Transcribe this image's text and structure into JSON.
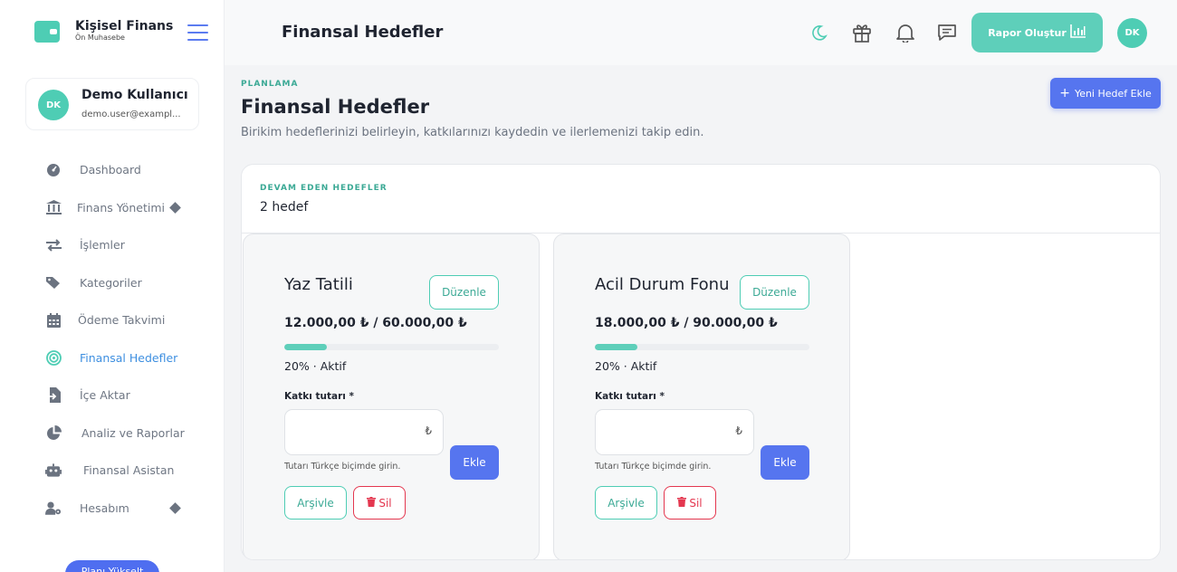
{
  "brand": {
    "title": "Kişisel Finans",
    "subtitle": "Ön Muhasebe"
  },
  "user": {
    "initials": "DK",
    "name": "Demo Kullanıcı",
    "email": "demo.user@exampl..."
  },
  "sidebar": {
    "items": [
      {
        "label": "Dashboard",
        "icon": "gauge-icon"
      },
      {
        "label": "Finans Yönetimi",
        "icon": "bank-icon",
        "expandable": true
      },
      {
        "label": "İşlemler",
        "icon": "exchange-icon"
      },
      {
        "label": "Kategoriler",
        "icon": "tags-icon"
      },
      {
        "label": "Ödeme Takvimi",
        "icon": "calendar-icon"
      },
      {
        "label": "Finansal Hedefler",
        "icon": "target-icon",
        "active": true
      },
      {
        "label": "İçe Aktar",
        "icon": "import-icon"
      },
      {
        "label": "Analiz ve Raporlar",
        "icon": "pie-chart-icon"
      },
      {
        "label": "Finansal Asistan",
        "icon": "robot-icon"
      },
      {
        "label": "Hesabım",
        "icon": "user-settings-icon",
        "expandable": true
      }
    ],
    "bottom_button": "Planı Yükselt"
  },
  "topbar": {
    "title": "Finansal Hedefler",
    "report_button": "Rapor Oluştur",
    "avatar": "DK",
    "icons": [
      "moon-icon",
      "gift-icon",
      "bell-icon",
      "chat-icon"
    ]
  },
  "page": {
    "eyebrow": "PLANLAMA",
    "title": "Finansal Hedefler",
    "subtitle": "Birikim hedeflerinizi belirleyin, katkılarınızı kaydedin ve ilerlemenizi takip edin.",
    "add_button": "Yeni Hedef Ekle"
  },
  "panel": {
    "eyebrow": "DEVAM EDEN HEDEFLER",
    "count": "2 hedef"
  },
  "goals": [
    {
      "name": "Yaz Tatili",
      "edit": "Düzenle",
      "amount": "12.000,00 ₺ / 60.000,00 ₺",
      "progress": 0.2,
      "status": "20% · Aktif",
      "field_label": "Katkı tutarı *",
      "currency": "₺",
      "hint": "Tutarı Türkçe biçimde girin.",
      "add": "Ekle",
      "archive": "Arşivle",
      "delete": "Sil"
    },
    {
      "name": "Acil Durum Fonu",
      "edit": "Düzenle",
      "amount": "18.000,00 ₺ / 90.000,00 ₺",
      "progress": 0.2,
      "status": "20% · Aktif",
      "field_label": "Katkı tutarı *",
      "currency": "₺",
      "hint": "Tutarı Türkçe biçimde girin.",
      "add": "Ekle",
      "archive": "Arşivle",
      "delete": "Sil"
    }
  ],
  "colors": {
    "accent": "#4ecdb4",
    "primary": "#5675ef",
    "danger": "#e4374f"
  }
}
